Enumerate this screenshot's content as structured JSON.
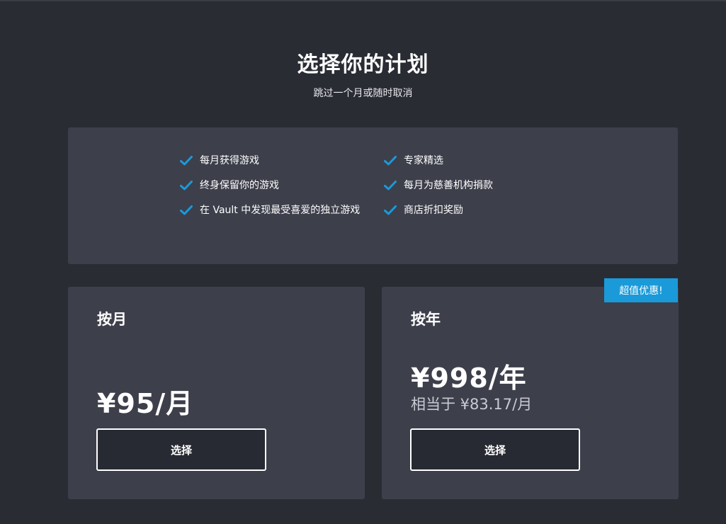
{
  "header": {
    "title": "选择你的计划",
    "subtitle": "跳过一个月或随时取消"
  },
  "features": {
    "left": [
      "每月获得游戏",
      "终身保留你的游戏",
      "在 Vault 中发现最受喜爱的独立游戏"
    ],
    "right": [
      "专家精选",
      "每月为慈善机构捐款",
      "商店折扣奖励"
    ],
    "check_color": "#1a9ad9"
  },
  "plans": {
    "monthly": {
      "name": "按月",
      "price": "¥95/月",
      "button_label": "选择"
    },
    "yearly": {
      "name": "按年",
      "price": "¥998/年",
      "equivalent": "相当于 ¥83.17/月",
      "button_label": "选择",
      "badge": "超值优惠!"
    }
  },
  "colors": {
    "background": "#2a2c34",
    "card": "#3d3f4b",
    "accent": "#1a9ad9"
  }
}
